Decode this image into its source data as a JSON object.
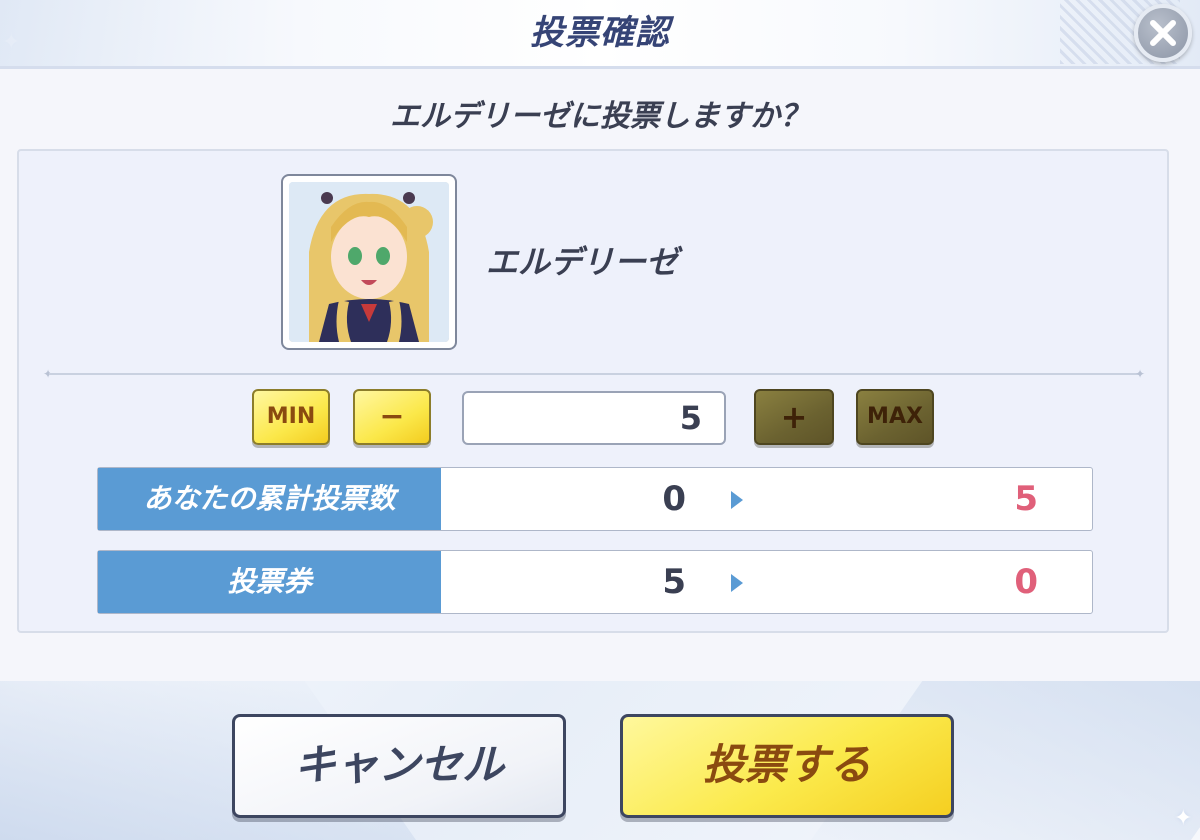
{
  "dialog": {
    "title": "投票確認",
    "question": "エルデリーゼに投票しますか？"
  },
  "character": {
    "name": "エルデリーゼ"
  },
  "stepper": {
    "min_label": "MIN",
    "minus_label": "−",
    "value": "5",
    "plus_label": "+",
    "max_label": "MAX"
  },
  "stats": [
    {
      "label": "あなたの累計投票数",
      "before": "0",
      "after": "5"
    },
    {
      "label": "投票券",
      "before": "5",
      "after": "0"
    }
  ],
  "actions": {
    "cancel_label": "キャンセル",
    "vote_label": "投票する"
  },
  "colors": {
    "title": "#364476",
    "stat_label_bg": "#5a9bd4",
    "after_value": "#e0607a",
    "yellow_button": "#fbe84a",
    "olive_button": "#6b6230"
  }
}
